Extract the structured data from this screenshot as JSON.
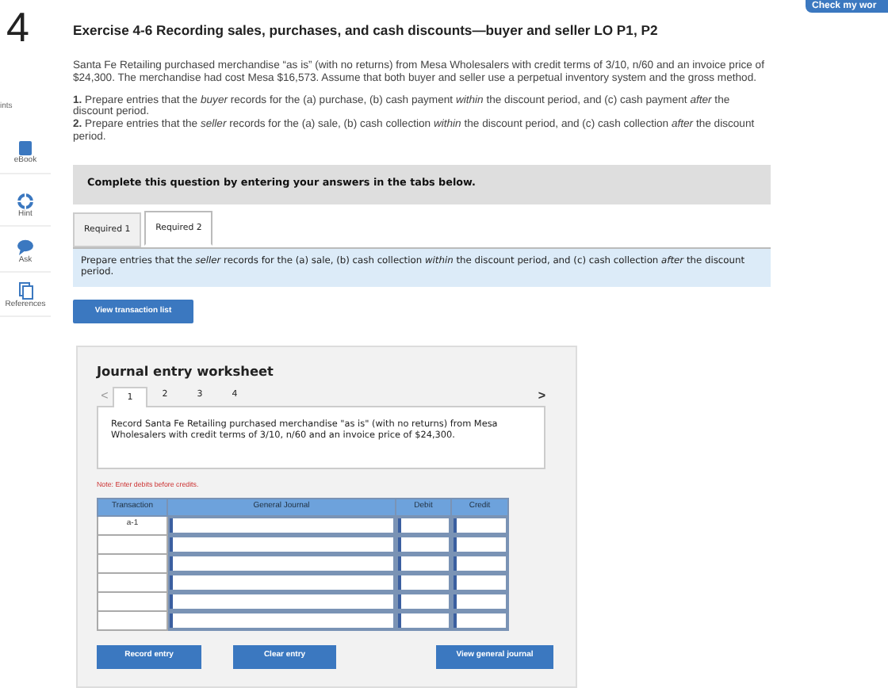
{
  "question_number": "4",
  "check_button": "Check my wor",
  "sidebar": {
    "points_label": "ints",
    "items": [
      {
        "kind": "ebook",
        "label": "eBook"
      },
      {
        "kind": "hint",
        "label": "Hint"
      },
      {
        "kind": "ask",
        "label": "Ask"
      },
      {
        "kind": "references",
        "label": "References"
      }
    ]
  },
  "title": "Exercise 4-6 Recording sales, purchases, and cash discounts—buyer and seller LO P1, P2",
  "intro": "Santa Fe Retailing purchased merchandise “as is” (with no returns) from Mesa Wholesalers with credit terms of 3/10, n/60 and an invoice price of $24,300. The merchandise had cost Mesa $16,573. Assume that both buyer and seller use a perpetual inventory system and the gross method.",
  "instructions": [
    "**1.** Prepare entries that the *buyer* records for the (a) purchase, (b) cash payment *within* the discount period, and (c) cash payment *after* the discount period.",
    "**2.** Prepare entries that the *seller* records for the (a) sale, (b) cash collection *within* the discount period, and (c) cash collection *after* the discount period."
  ],
  "banner": "Complete this question by entering your answers in the tabs below.",
  "tabs": [
    {
      "label": "Required 1",
      "selected": false
    },
    {
      "label": "Required 2",
      "selected": true
    }
  ],
  "tab_prompt": "Prepare entries that the *seller* records for the (a) sale, (b) cash collection *within* the discount period, and (c) cash collection *after* the discount period.",
  "transaction_list_button": "View transaction list",
  "worksheet": {
    "title": "Journal entry worksheet",
    "prev": "<",
    "next": ">",
    "pages": [
      {
        "label": "1",
        "selected": true
      },
      {
        "label": "2",
        "selected": false
      },
      {
        "label": "3",
        "selected": false
      },
      {
        "label": "4",
        "selected": false
      }
    ],
    "prompt": "Record Santa Fe Retailing purchased merchandise \"as is\" (with no returns) from Mesa Wholesalers with credit terms of 3/10, n/60 and an invoice price of $24,300.",
    "note": "Note: Enter debits before credits.",
    "columns": [
      "Transaction",
      "General Journal",
      "Debit",
      "Credit"
    ],
    "rows": [
      {
        "transaction": "a-1"
      },
      {},
      {},
      {},
      {},
      {}
    ],
    "buttons": [
      "Record entry",
      "Clear entry",
      "View general journal"
    ]
  }
}
